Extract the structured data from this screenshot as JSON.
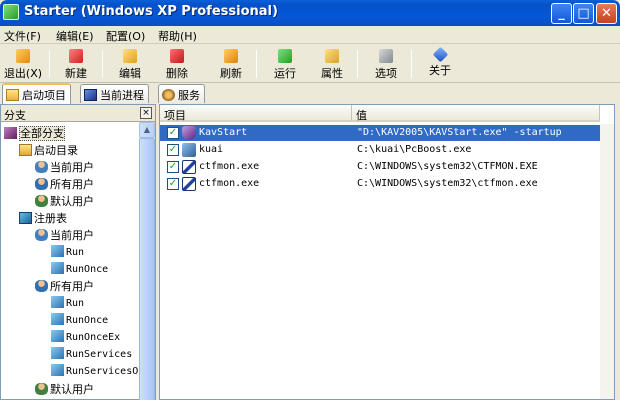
{
  "window": {
    "title": "Starter (Windows XP Professional)",
    "minimize": "_",
    "maximize": "□",
    "close": "✕"
  },
  "menu": [
    "文件(F)",
    "编辑(E)",
    "配置(O)",
    "帮助(H)"
  ],
  "toolbar": [
    "退出(X)",
    "新建",
    "编辑",
    "删除",
    "刷新",
    "运行",
    "属性",
    "选项",
    "关于"
  ],
  "tabs": [
    "启动项目",
    "当前进程",
    "服务"
  ],
  "left_panel": {
    "title": "分支",
    "close": "×",
    "tree": [
      "全部分支",
      "启动目录",
      "当前用户",
      "所有用户",
      "默认用户",
      "注册表",
      "当前用户",
      "Run",
      "RunOnce",
      "所有用户",
      "Run",
      "RunOnce",
      "RunOnceEx",
      "RunServices",
      "RunServicesO:",
      "默认用户"
    ]
  },
  "right_panel": {
    "columns": [
      "项目",
      "值"
    ],
    "rows": [
      {
        "name": "KavStart",
        "value": "\"D:\\KAV2005\\KAVStart.exe\" -startup",
        "checked": "✓"
      },
      {
        "name": "kuai",
        "value": "C:\\kuai\\PcBoost.exe",
        "checked": "✓"
      },
      {
        "name": "ctfmon.exe",
        "value": "C:\\WINDOWS\\system32\\CTFMON.EXE",
        "checked": "✓"
      },
      {
        "name": "ctfmon.exe",
        "value": "C:\\WINDOWS\\system32\\ctfmon.exe",
        "checked": "✓"
      }
    ]
  },
  "scroll": {
    "up": "▲"
  },
  "colors": {
    "title_bar": "#0a5fd8",
    "selection": "#316ac5",
    "face": "#ece9d8"
  }
}
